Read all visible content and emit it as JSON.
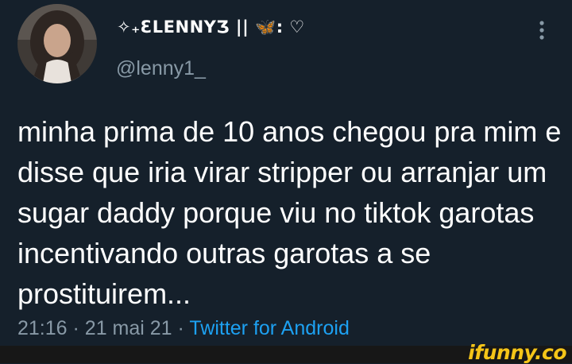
{
  "tweet": {
    "display_name": "✧₊ƐLENNYƷ || 🦋: ♡",
    "handle": "@lenny1_",
    "text": "minha prima de 10 anos chegou pra mim e disse que iria virar stripper ou arranjar um sugar daddy porque viu no tiktok garotas incentivando outras garotas a se prostituirem...",
    "time": "21:16",
    "separator": "·",
    "date": "21 mai 21",
    "source": "Twitter for Android"
  },
  "icons": {
    "avatar": "profile-photo",
    "more": "vertical-ellipsis-icon"
  },
  "watermark": {
    "text": "ifunny.co"
  },
  "colors": {
    "background": "#15202b",
    "text": "#ffffff",
    "secondary_text": "#8899a6",
    "link": "#1da1f2",
    "watermark": "#f5c518",
    "watermark_bar": "#171717"
  }
}
